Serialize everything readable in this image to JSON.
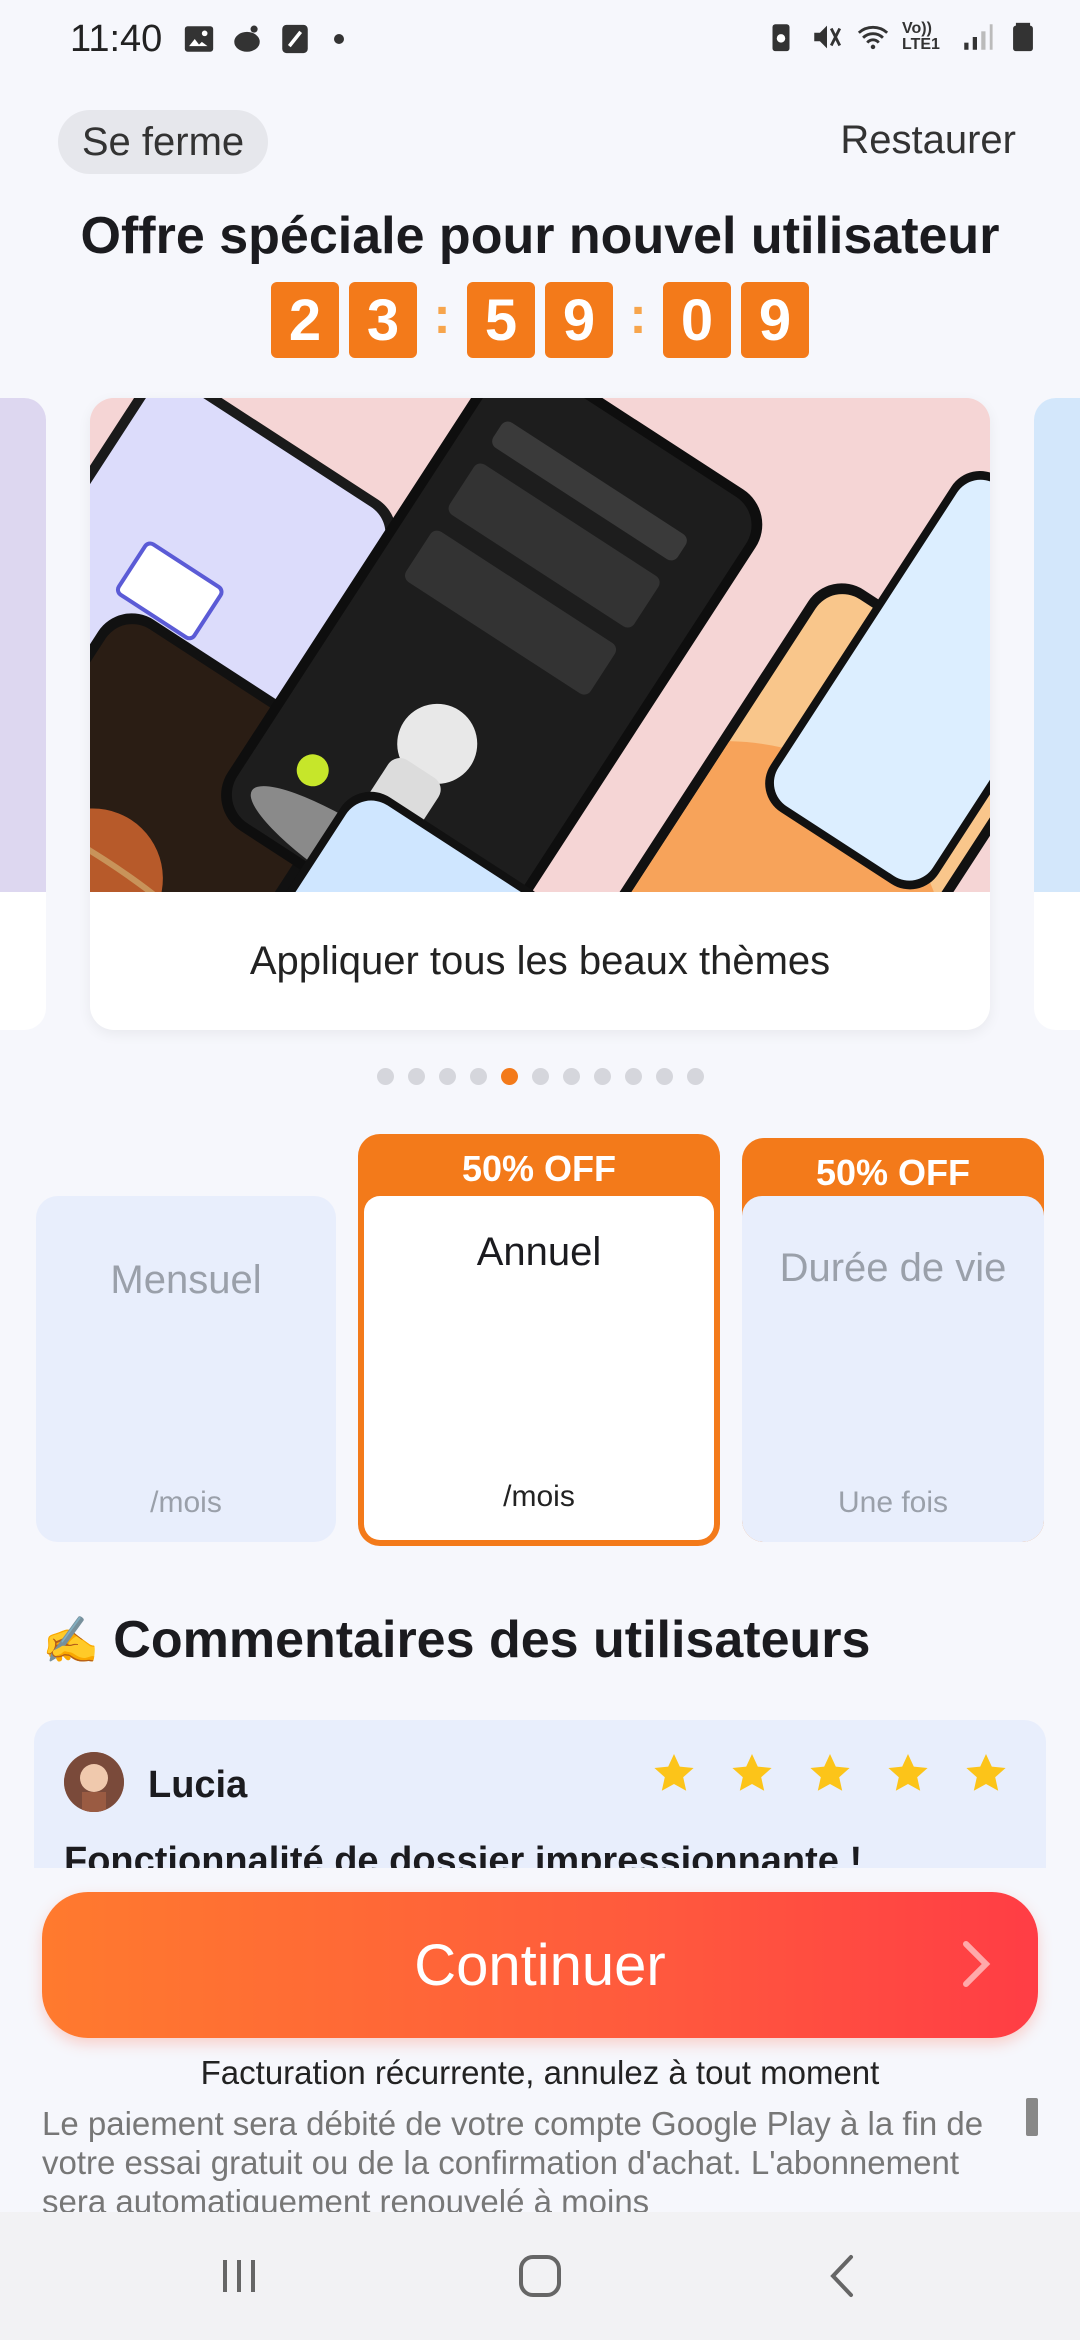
{
  "status_bar": {
    "time": "11:40",
    "network_label": "Vo)) LTE1"
  },
  "header": {
    "close_label": "Se ferme",
    "restore_label": "Restaurer",
    "offer_title": "Offre spéciale pour nouvel utilisateur"
  },
  "countdown": {
    "hours": [
      "2",
      "3"
    ],
    "minutes": [
      "5",
      "9"
    ],
    "seconds": [
      "0",
      "9"
    ]
  },
  "carousel": {
    "caption": "Appliquer tous les beaux thèmes",
    "slide_count": 11,
    "active_index": 4
  },
  "plans": {
    "monthly": {
      "name": "Mensuel",
      "period": "/mois"
    },
    "annual": {
      "badge": "50% OFF",
      "name": "Annuel",
      "period": "/mois"
    },
    "lifetime": {
      "badge": "50% OFF",
      "name": "Durée de vie",
      "period": "Une fois"
    }
  },
  "comments": {
    "emoji": "✍️",
    "title": "Commentaires des utilisateurs",
    "review": {
      "name": "Lucia",
      "rating": 5,
      "title": "Fonctionnalité de dossier impressionnante !"
    }
  },
  "cta": {
    "continue_label": "Continuer",
    "billing_note": "Facturation récurrente, annulez à tout moment",
    "legal": "Le paiement sera débité de votre compte Google Play à la fin de votre essai gratuit ou de la confirmation d'achat. L'abonnement sera automatiquement renouvelé à moins"
  },
  "colors": {
    "accent": "#f37a1a",
    "button_start": "#ff7a2e",
    "button_end": "#ff3d45",
    "star": "#fcc419"
  }
}
